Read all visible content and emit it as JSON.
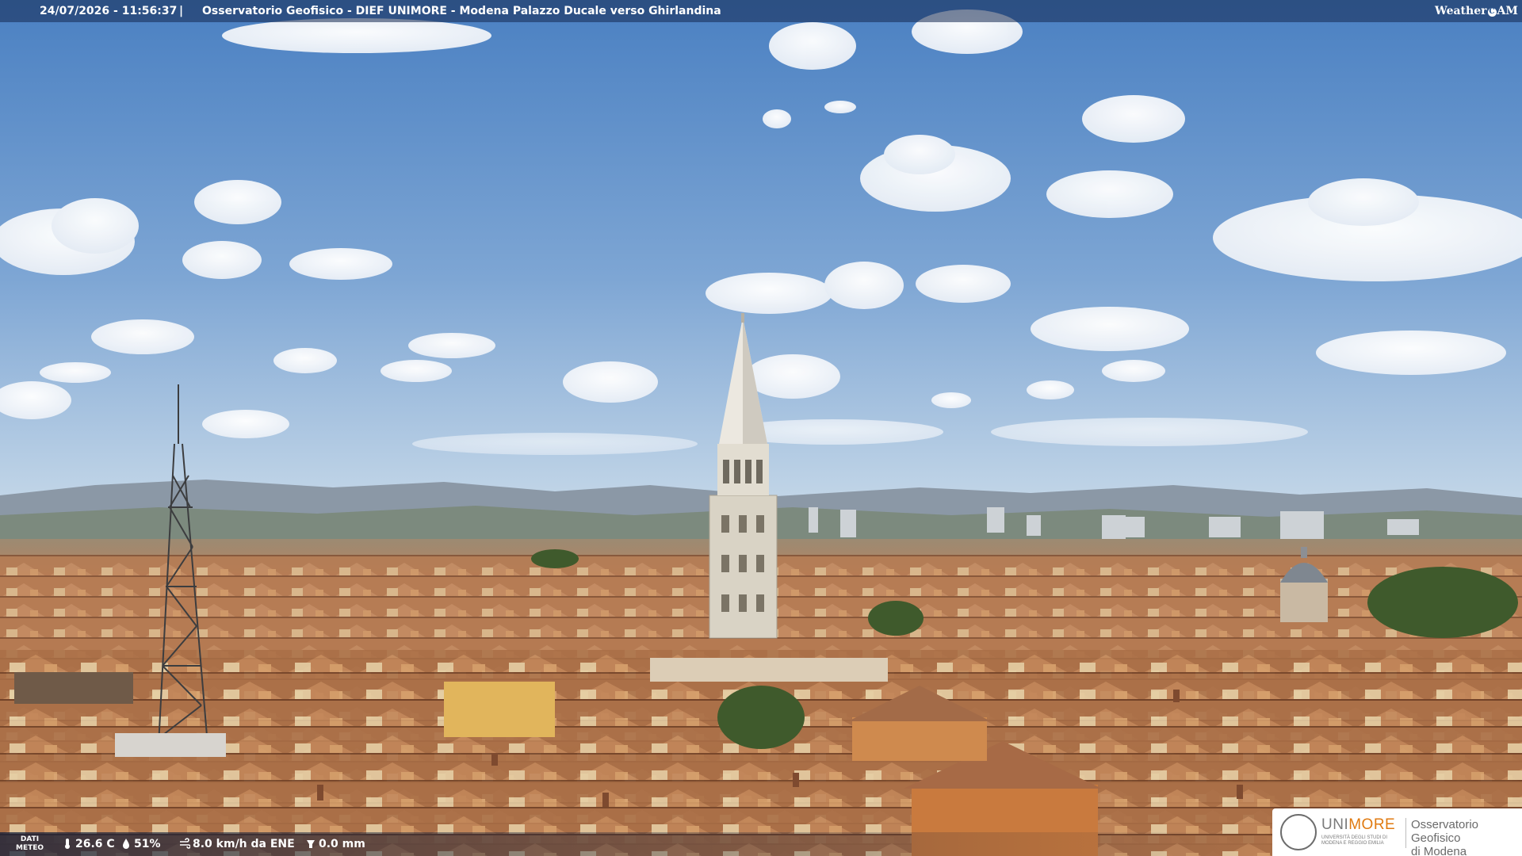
{
  "overlay": {
    "timestamp": "24/07/2026 - 11:56:37",
    "separator": "|",
    "title": "Osservatorio Geofisico - DIEF UNIMORE - Modena Palazzo Ducale verso Ghirlandina",
    "logo": {
      "word": "Weather",
      "cam_letter": "C",
      "cam_rest": "AM"
    }
  },
  "meteo": {
    "label_line1": "DATI",
    "label_line2": "METEO",
    "temperature": "26.6 C",
    "humidity": "51%",
    "wind": "8.0 km/h da ENE",
    "rain": "0.0 mm",
    "icons": [
      "thermometer-icon",
      "humidity-icon",
      "wind-icon",
      "rain-gauge-icon"
    ]
  },
  "institution": {
    "brand_a": "UNI",
    "brand_b": "MORE",
    "brand_sub": "UNIVERSITÀ DEGLI STUDI DI MODENA E REGGIO EMILIA",
    "observatory_line1": "Osservatorio Geofisico",
    "observatory_line2": "di Modena"
  },
  "colors": {
    "sky_top": "#4f86c6",
    "sky_horizon": "#b9d0e6",
    "roofs": "#b5794f",
    "tower": "#d8d2c6",
    "unimore_orange": "#e07a10"
  }
}
